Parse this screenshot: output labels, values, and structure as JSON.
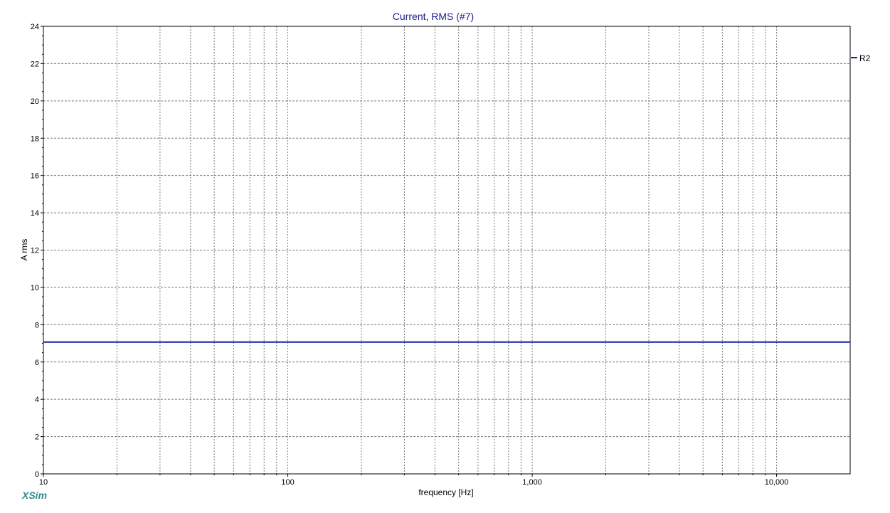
{
  "app": {
    "brand": "XSim"
  },
  "chart_data": {
    "type": "line",
    "title": "Current, RMS (#7)",
    "xlabel": "frequency [Hz]",
    "ylabel": "A rms",
    "xscale": "log",
    "xlim": [
      10,
      20000
    ],
    "ylim": [
      0,
      24
    ],
    "xticks": [
      10,
      100,
      1000,
      10000
    ],
    "xtick_labels": [
      "10",
      "100",
      "1,000",
      "10,000"
    ],
    "yticks": [
      0,
      2,
      4,
      6,
      8,
      10,
      12,
      14,
      16,
      18,
      20,
      22,
      24
    ],
    "ytick_labels": [
      "0",
      "2",
      "4",
      "6",
      "8",
      "10",
      "12",
      "14",
      "16",
      "18",
      "20",
      "22",
      "24"
    ],
    "grid": true,
    "legend_position": "right",
    "series": [
      {
        "name": "R2",
        "color": "#0a1fae",
        "x": [
          10,
          20000
        ],
        "y": [
          7.07,
          7.07
        ]
      }
    ]
  }
}
